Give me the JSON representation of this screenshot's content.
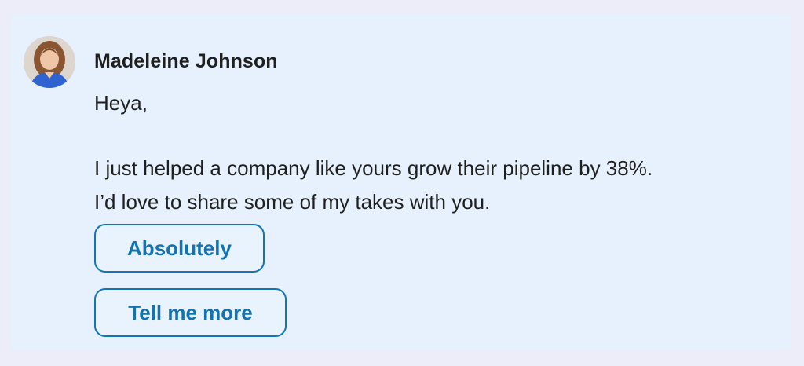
{
  "message": {
    "sender_name": "Madeleine Johnson",
    "greeting": "Heya,",
    "body_line_1": "I just helped a company like yours grow their pipeline by 38%.",
    "body_line_2": "I’d love to share some of my takes with you."
  },
  "avatar": {
    "icon": "profile-photo"
  },
  "replies": [
    {
      "label": "Absolutely"
    },
    {
      "label": "Tell me more"
    }
  ],
  "colors": {
    "page_background": "#ecedf8",
    "card_background": "#e6f1fd",
    "accent": "#1373b0",
    "text": "#1f1f1f"
  }
}
